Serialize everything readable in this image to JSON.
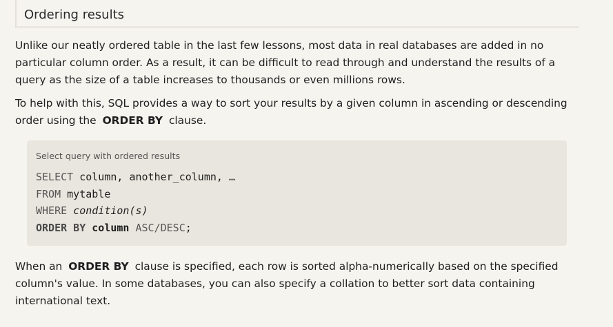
{
  "section": {
    "title": "Ordering results"
  },
  "paragraphs": {
    "p1": "Unlike our neatly ordered table in the last few lessons, most data in real databases are added in no particular column order. As a result, it can be difficult to read through and understand the results of a query as the size of a table increases to thousands or even millions rows.",
    "p2_before": "To help with this, SQL provides a way to sort your results by a given column in ascending or descending order using the",
    "p2_keyword": "ORDER BY",
    "p2_after": "clause.",
    "p3_before": "When an",
    "p3_keyword": "ORDER BY",
    "p3_after": "clause is specified, each row is sorted alpha-numerically based on the specified column's value. In some databases, you can also specify a collation to better sort data containing international text."
  },
  "code": {
    "caption": "Select query with ordered results",
    "line1_kw": "SELECT",
    "line1_rest": " column, another_column, …",
    "line2_kw": "FROM",
    "line2_rest": " mytable",
    "line3_kw": "WHERE",
    "line3_rest": "condition(s)",
    "line4_kw": "ORDER BY",
    "line4_col": "column",
    "line4_dir": "ASC/DESC",
    "line4_end": ";"
  }
}
